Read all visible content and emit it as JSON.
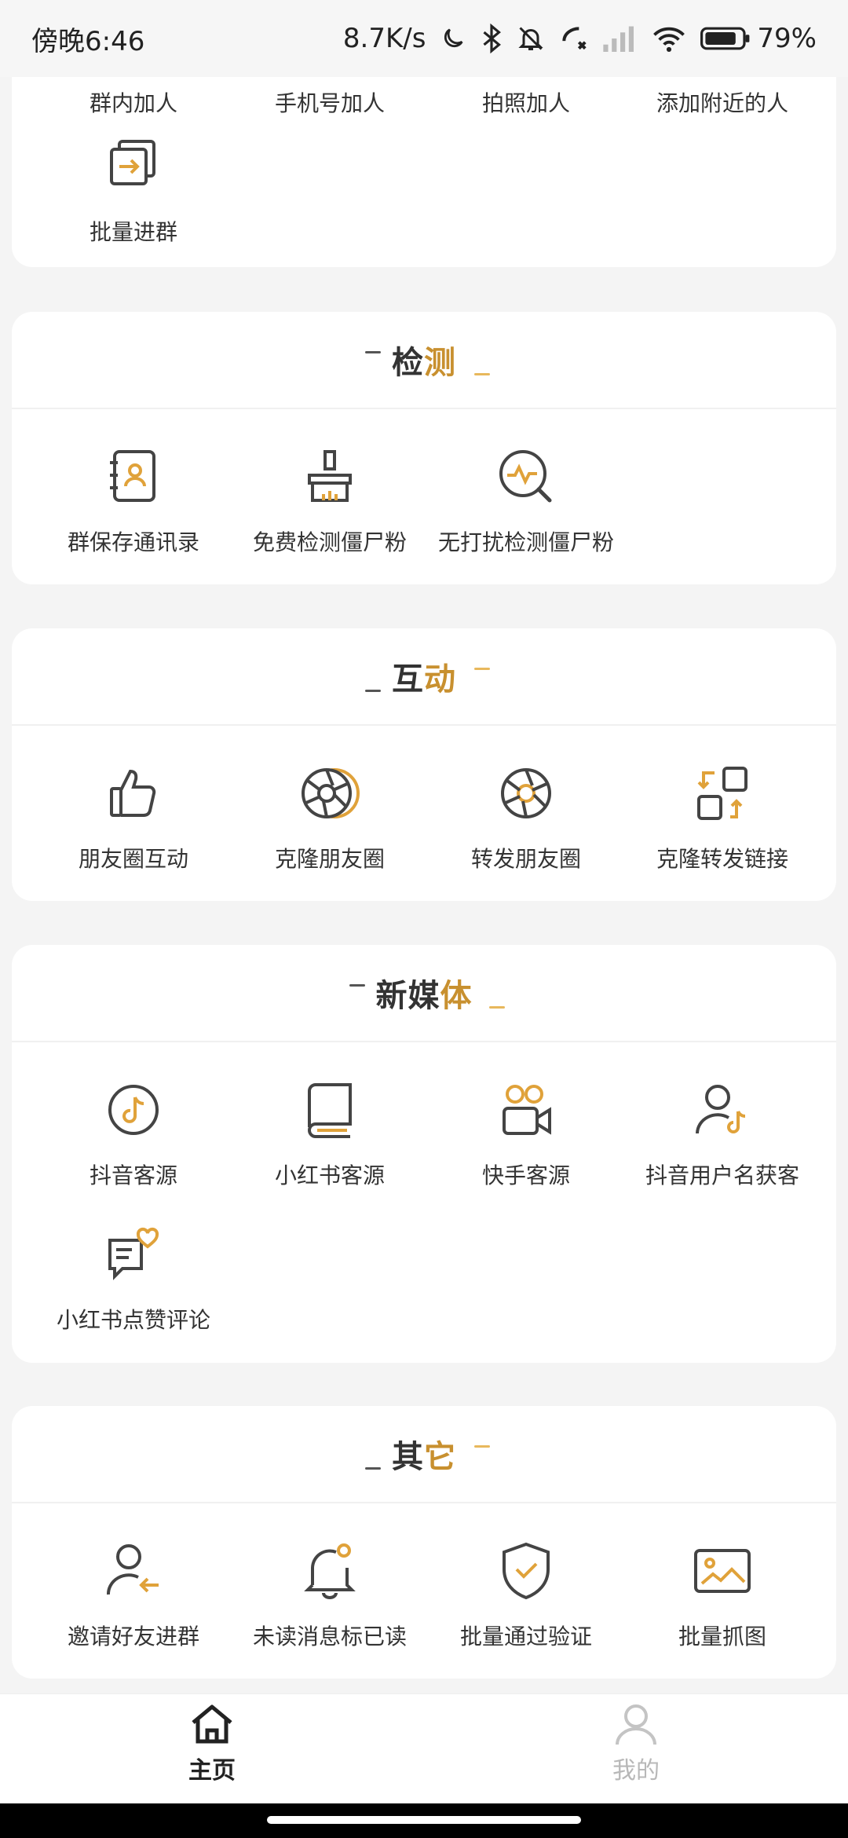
{
  "status_bar": {
    "time": "傍晚6:46",
    "network_speed": "8.7K/s",
    "battery": "79%"
  },
  "sections": {
    "top": {
      "items": [
        {
          "label": "群内加人",
          "icon": "users-icon"
        },
        {
          "label": "手机号加人",
          "icon": "phone-icon"
        },
        {
          "label": "拍照加人",
          "icon": "camera-icon"
        },
        {
          "label": "添加附近的人",
          "icon": "location-icon"
        },
        {
          "label": "批量进群",
          "icon": "batch-enter-icon"
        }
      ]
    },
    "detect": {
      "title_main": "检",
      "title_accent": "测",
      "items": [
        {
          "label": "群保存通讯录",
          "icon": "contact-book-icon"
        },
        {
          "label": "免费检测僵尸粉",
          "icon": "brush-icon"
        },
        {
          "label": "无打扰检测僵尸粉",
          "icon": "search-pulse-icon"
        }
      ]
    },
    "interact": {
      "title_main": "互",
      "title_accent": "动",
      "items": [
        {
          "label": "朋友圈互动",
          "icon": "thumbs-up-icon"
        },
        {
          "label": "克隆朋友圈",
          "icon": "aperture-clone-icon"
        },
        {
          "label": "转发朋友圈",
          "icon": "aperture-icon"
        },
        {
          "label": "克隆转发链接",
          "icon": "grid-swap-icon"
        }
      ]
    },
    "media": {
      "title_main": "新媒",
      "title_accent": "体",
      "items": [
        {
          "label": "抖音客源",
          "icon": "tiktok-circle-icon"
        },
        {
          "label": "小红书客源",
          "icon": "book-icon"
        },
        {
          "label": "快手客源",
          "icon": "video-camera-icon"
        },
        {
          "label": "抖音用户名获客",
          "icon": "user-music-icon"
        },
        {
          "label": "小红书点赞评论",
          "icon": "comment-heart-icon"
        }
      ]
    },
    "other": {
      "title_main": "其",
      "title_accent": "它",
      "items": [
        {
          "label": "邀请好友进群",
          "icon": "invite-user-icon"
        },
        {
          "label": "未读消息标已读",
          "icon": "bell-icon"
        },
        {
          "label": "批量通过验证",
          "icon": "shield-check-icon"
        },
        {
          "label": "批量抓图",
          "icon": "image-icon"
        }
      ]
    }
  },
  "bottom_nav": {
    "home": "主页",
    "mine": "我的"
  },
  "colors": {
    "accent": "#c8902f",
    "accent_light": "#e8b85c",
    "icon_dark": "#444444"
  }
}
